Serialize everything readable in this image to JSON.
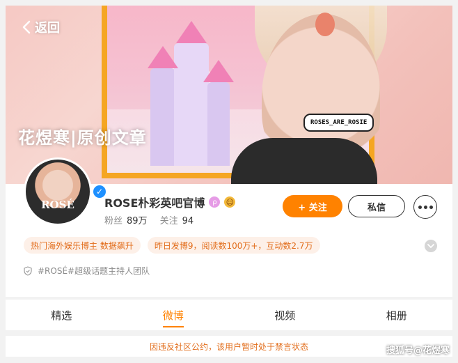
{
  "header": {
    "back_label": "返回",
    "banner_text": "花煜寒|原创文章",
    "sticker_text": "ROSES_ARE_ROSIE"
  },
  "profile": {
    "avatar_text": "ROSÉ",
    "name": "ROSE朴彩英吧官博",
    "fans_label": "粉丝",
    "fans_value": "89万",
    "following_label": "关注",
    "following_value": "94",
    "follow_button": "+ 关注",
    "message_button": "私信",
    "tags": [
      "热门海外娱乐博主 数据飙升",
      "昨日发博9，阅读数100万+，互动数2.7万"
    ],
    "team_text": "#ROSÉ#超级话题主持人团队"
  },
  "tabs": [
    {
      "label": "精选",
      "active": false
    },
    {
      "label": "微博",
      "active": true
    },
    {
      "label": "视频",
      "active": false
    },
    {
      "label": "相册",
      "active": false
    }
  ],
  "notice": "因违反社区公约，该用户暂时处于禁言状态",
  "watermark": "搜狐号@花煜寒",
  "colors": {
    "accent": "#ff8200",
    "tag_text": "#e26d1b",
    "tag_bg": "#fdf0e8",
    "verified": "#1e90ff"
  }
}
